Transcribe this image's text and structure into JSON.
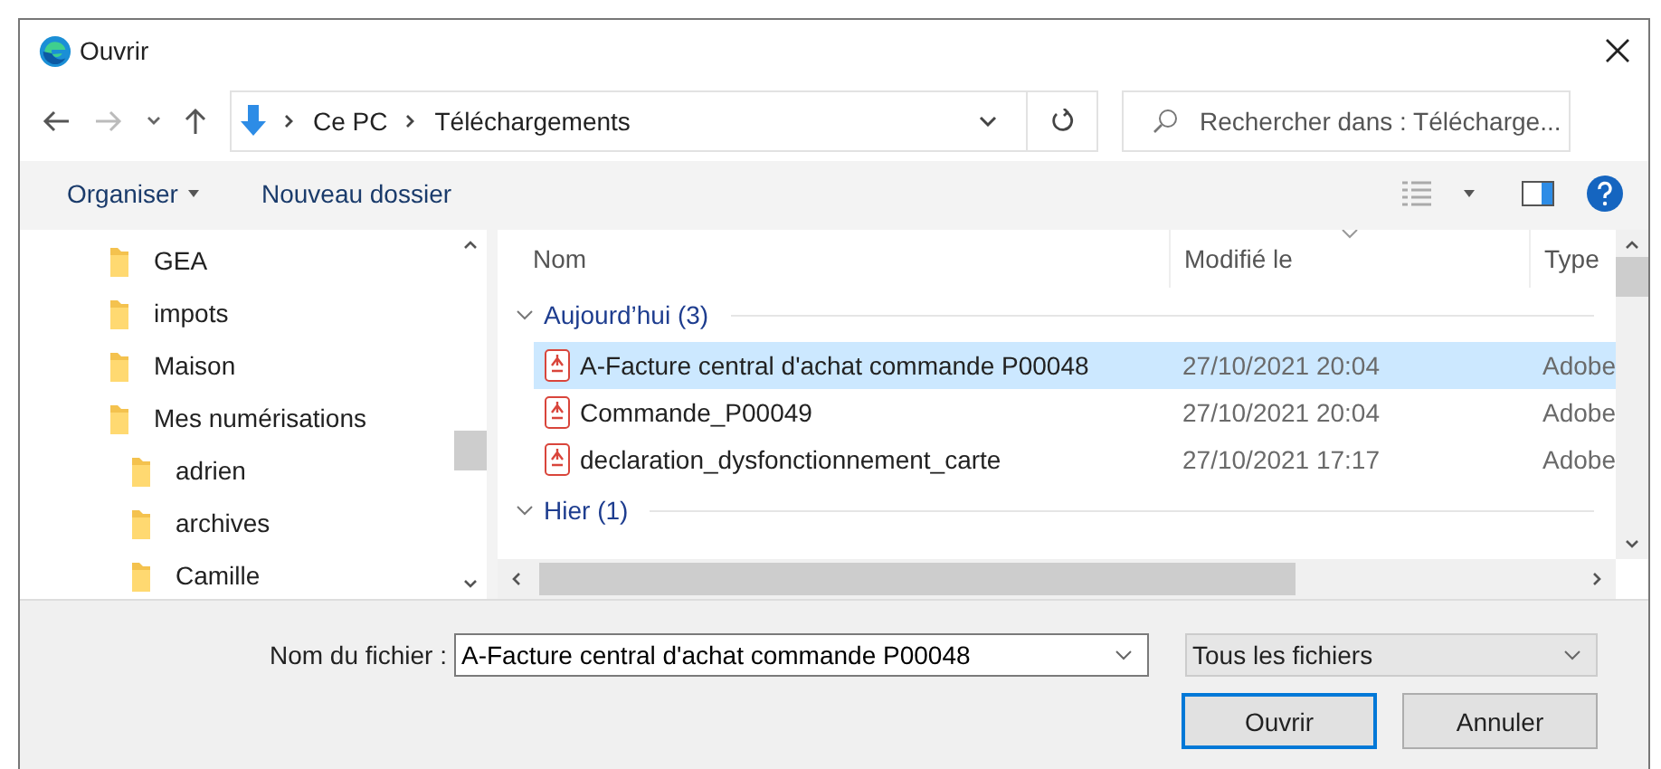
{
  "window": {
    "title": "Ouvrir"
  },
  "nav": {
    "breadcrumb": [
      "Ce PC",
      "Téléchargements"
    ],
    "search_placeholder": "Rechercher dans : Télécharge..."
  },
  "toolbar": {
    "organize": "Organiser",
    "new_folder": "Nouveau dossier"
  },
  "sidebar": {
    "items": [
      {
        "label": "GEA"
      },
      {
        "label": "impots"
      },
      {
        "label": "Maison"
      },
      {
        "label": "Mes numérisations",
        "children": [
          {
            "label": "adrien"
          },
          {
            "label": "archives"
          },
          {
            "label": "Camille"
          }
        ]
      }
    ]
  },
  "table": {
    "columns": [
      "Nom",
      "Modifié le",
      "Type"
    ],
    "groups": [
      {
        "label": "Aujourd’hui (3)",
        "expanded": true,
        "rows": [
          {
            "name": "A-Facture central d'achat commande P00048",
            "modified": "27/10/2021 20:04",
            "type": "Adobe",
            "selected": true
          },
          {
            "name": "Commande_P00049",
            "modified": "27/10/2021 20:04",
            "type": "Adobe",
            "selected": false
          },
          {
            "name": "declaration_dysfonctionnement_carte",
            "modified": "27/10/2021 17:17",
            "type": "Adobe",
            "selected": false
          }
        ]
      },
      {
        "label": "Hier (1)",
        "expanded": true
      }
    ]
  },
  "footer": {
    "filename_label": "Nom du fichier :",
    "filename": "A-Facture central d'achat commande P00048",
    "filter": "Tous les fichiers",
    "buttons": [
      "Ouvrir",
      "Annuler"
    ]
  }
}
